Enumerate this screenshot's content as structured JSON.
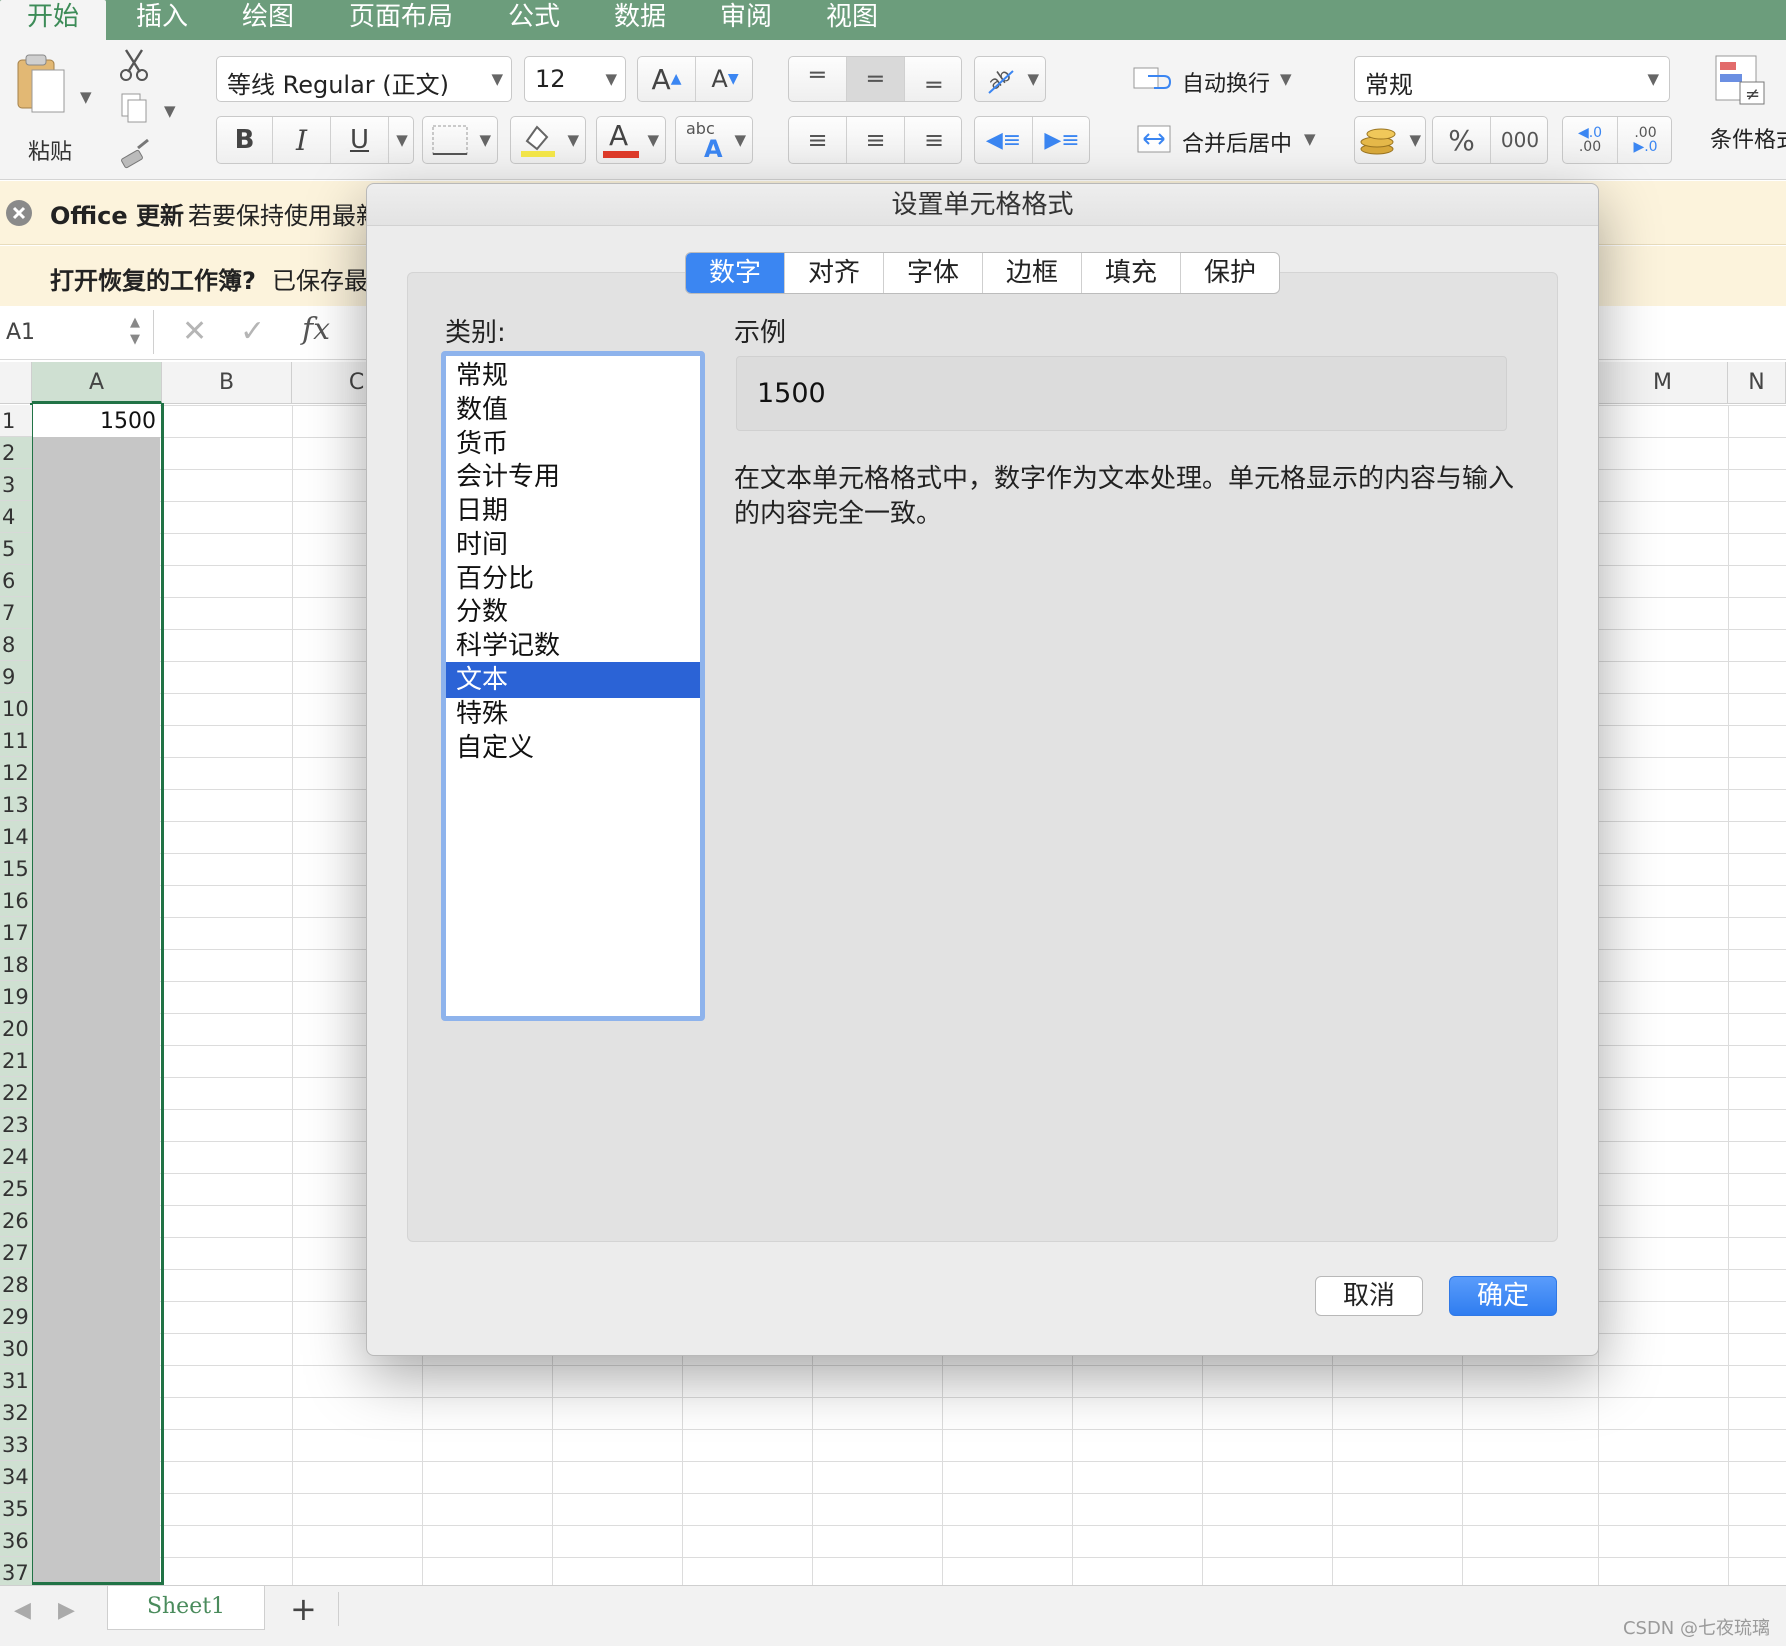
{
  "ribbon": {
    "tabs": [
      "开始",
      "插入",
      "绘图",
      "页面布局",
      "公式",
      "数据",
      "审阅",
      "视图"
    ],
    "active_tab": "开始"
  },
  "toolbar": {
    "paste_label": "粘贴",
    "font_name": "等线 Regular (正文)",
    "font_size": "12",
    "bold": "B",
    "italic": "I",
    "underline": "U",
    "font_color_glyph": "A",
    "wrap_text": "自动换行",
    "merge_center": "合并后居中",
    "number_format": "常规",
    "percent": "%",
    "thousands": "000",
    "increase_decimal": ".0\n.00",
    "cond_format": "条件格式"
  },
  "notices": {
    "update_title": "Office 更新",
    "update_text": "若要保持使用最新",
    "recover_title": "打开恢复的工作簿?",
    "recover_text": "已保存最"
  },
  "formula_bar": {
    "name_box": "A1",
    "fx": "fx"
  },
  "grid": {
    "columns": [
      "A",
      "B",
      "C",
      "M",
      "N"
    ],
    "rows": [
      "1",
      "2",
      "3",
      "4",
      "5",
      "6",
      "7",
      "8",
      "9",
      "10",
      "11",
      "12",
      "13",
      "14",
      "15",
      "16",
      "17",
      "18",
      "19",
      "20",
      "21",
      "22",
      "23",
      "24",
      "25",
      "26",
      "27",
      "28",
      "29",
      "30",
      "31",
      "32",
      "33",
      "34",
      "35",
      "36",
      "37"
    ],
    "cell_a1": "1500"
  },
  "dialog": {
    "title": "设置单元格格式",
    "tabs": [
      "数字",
      "对齐",
      "字体",
      "边框",
      "填充",
      "保护"
    ],
    "selected_tab": "数字",
    "category_label": "类别:",
    "categories": [
      "常规",
      "数值",
      "货币",
      "会计专用",
      "日期",
      "时间",
      "百分比",
      "分数",
      "科学记数",
      "文本",
      "特殊",
      "自定义"
    ],
    "selected_category": "文本",
    "sample_label": "示例",
    "sample_value": "1500",
    "description": "在文本单元格格式中，数字作为文本处理。单元格显示的内容与输入的内容完全一致。",
    "cancel": "取消",
    "ok": "确定"
  },
  "sheets": {
    "tabs": [
      "Sheet1"
    ],
    "add": "+"
  },
  "watermark": "CSDN @七夜琉璃",
  "colors": {
    "ribbon_green": "#6c9d7c",
    "selection_blue": "#2b63d6",
    "ok_blue": "#3b86f2",
    "cell_border_green": "#217346"
  }
}
